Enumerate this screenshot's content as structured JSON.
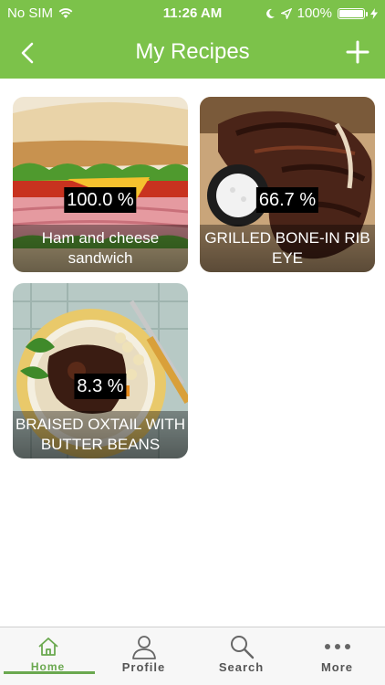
{
  "status_bar": {
    "carrier": "No SIM",
    "time": "11:26 AM",
    "battery": "100%"
  },
  "nav": {
    "title": "My Recipes",
    "back_icon": "chevron-left-icon",
    "add_icon": "plus-icon"
  },
  "recipes": [
    {
      "name": "Ham and cheese sandwich",
      "percent": "100.0 %"
    },
    {
      "name": "GRILLED BONE-IN RIB EYE",
      "percent": "66.7 %"
    },
    {
      "name": "BRAISED OXTAIL WITH BUTTER BEANS",
      "percent": "8.3 %"
    }
  ],
  "tabs": [
    {
      "label": "Home",
      "icon": "home-icon",
      "active": true
    },
    {
      "label": "Profile",
      "icon": "user-icon",
      "active": false
    },
    {
      "label": "Search",
      "icon": "search-icon",
      "active": false
    },
    {
      "label": "More",
      "icon": "more-icon",
      "active": false
    }
  ],
  "colors": {
    "brand": "#7cc24a",
    "active_tab": "#6aa84f"
  }
}
